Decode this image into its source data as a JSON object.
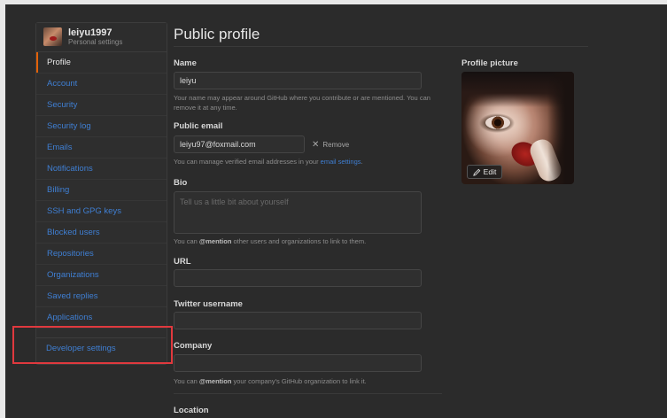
{
  "user": {
    "name": "leiyu1997",
    "subtitle": "Personal settings"
  },
  "sidebar": {
    "items": [
      {
        "label": "Profile",
        "active": true
      },
      {
        "label": "Account"
      },
      {
        "label": "Security"
      },
      {
        "label": "Security log"
      },
      {
        "label": "Emails"
      },
      {
        "label": "Notifications"
      },
      {
        "label": "Billing"
      },
      {
        "label": "SSH and GPG keys"
      },
      {
        "label": "Blocked users"
      },
      {
        "label": "Repositories"
      },
      {
        "label": "Organizations"
      },
      {
        "label": "Saved replies"
      },
      {
        "label": "Applications"
      }
    ],
    "developer_settings": "Developer settings"
  },
  "main": {
    "title": "Public profile",
    "name": {
      "label": "Name",
      "value": "leiyu",
      "note": "Your name may appear around GitHub where you contribute or are mentioned. You can remove it at any time."
    },
    "email": {
      "label": "Public email",
      "value": "leiyu97@foxmail.com",
      "remove_label": "Remove",
      "note_prefix": "You can manage verified email addresses in your ",
      "note_link": "email settings",
      "note_suffix": "."
    },
    "bio": {
      "label": "Bio",
      "placeholder": "Tell us a little bit about yourself",
      "note_prefix": "You can ",
      "note_bold": "@mention",
      "note_suffix": " other users and organizations to link to them."
    },
    "url": {
      "label": "URL",
      "value": ""
    },
    "twitter": {
      "label": "Twitter username",
      "value": ""
    },
    "company": {
      "label": "Company",
      "value": "",
      "note_prefix": "You can ",
      "note_bold": "@mention",
      "note_suffix": " your company's GitHub organization to link it."
    },
    "location": {
      "label": "Location"
    }
  },
  "profile_picture": {
    "label": "Profile picture",
    "edit_label": "Edit"
  },
  "colors": {
    "accent": "#e36209",
    "link": "#3f7fd3",
    "highlight_box": "#e0393e",
    "background": "#2b2b2b"
  }
}
